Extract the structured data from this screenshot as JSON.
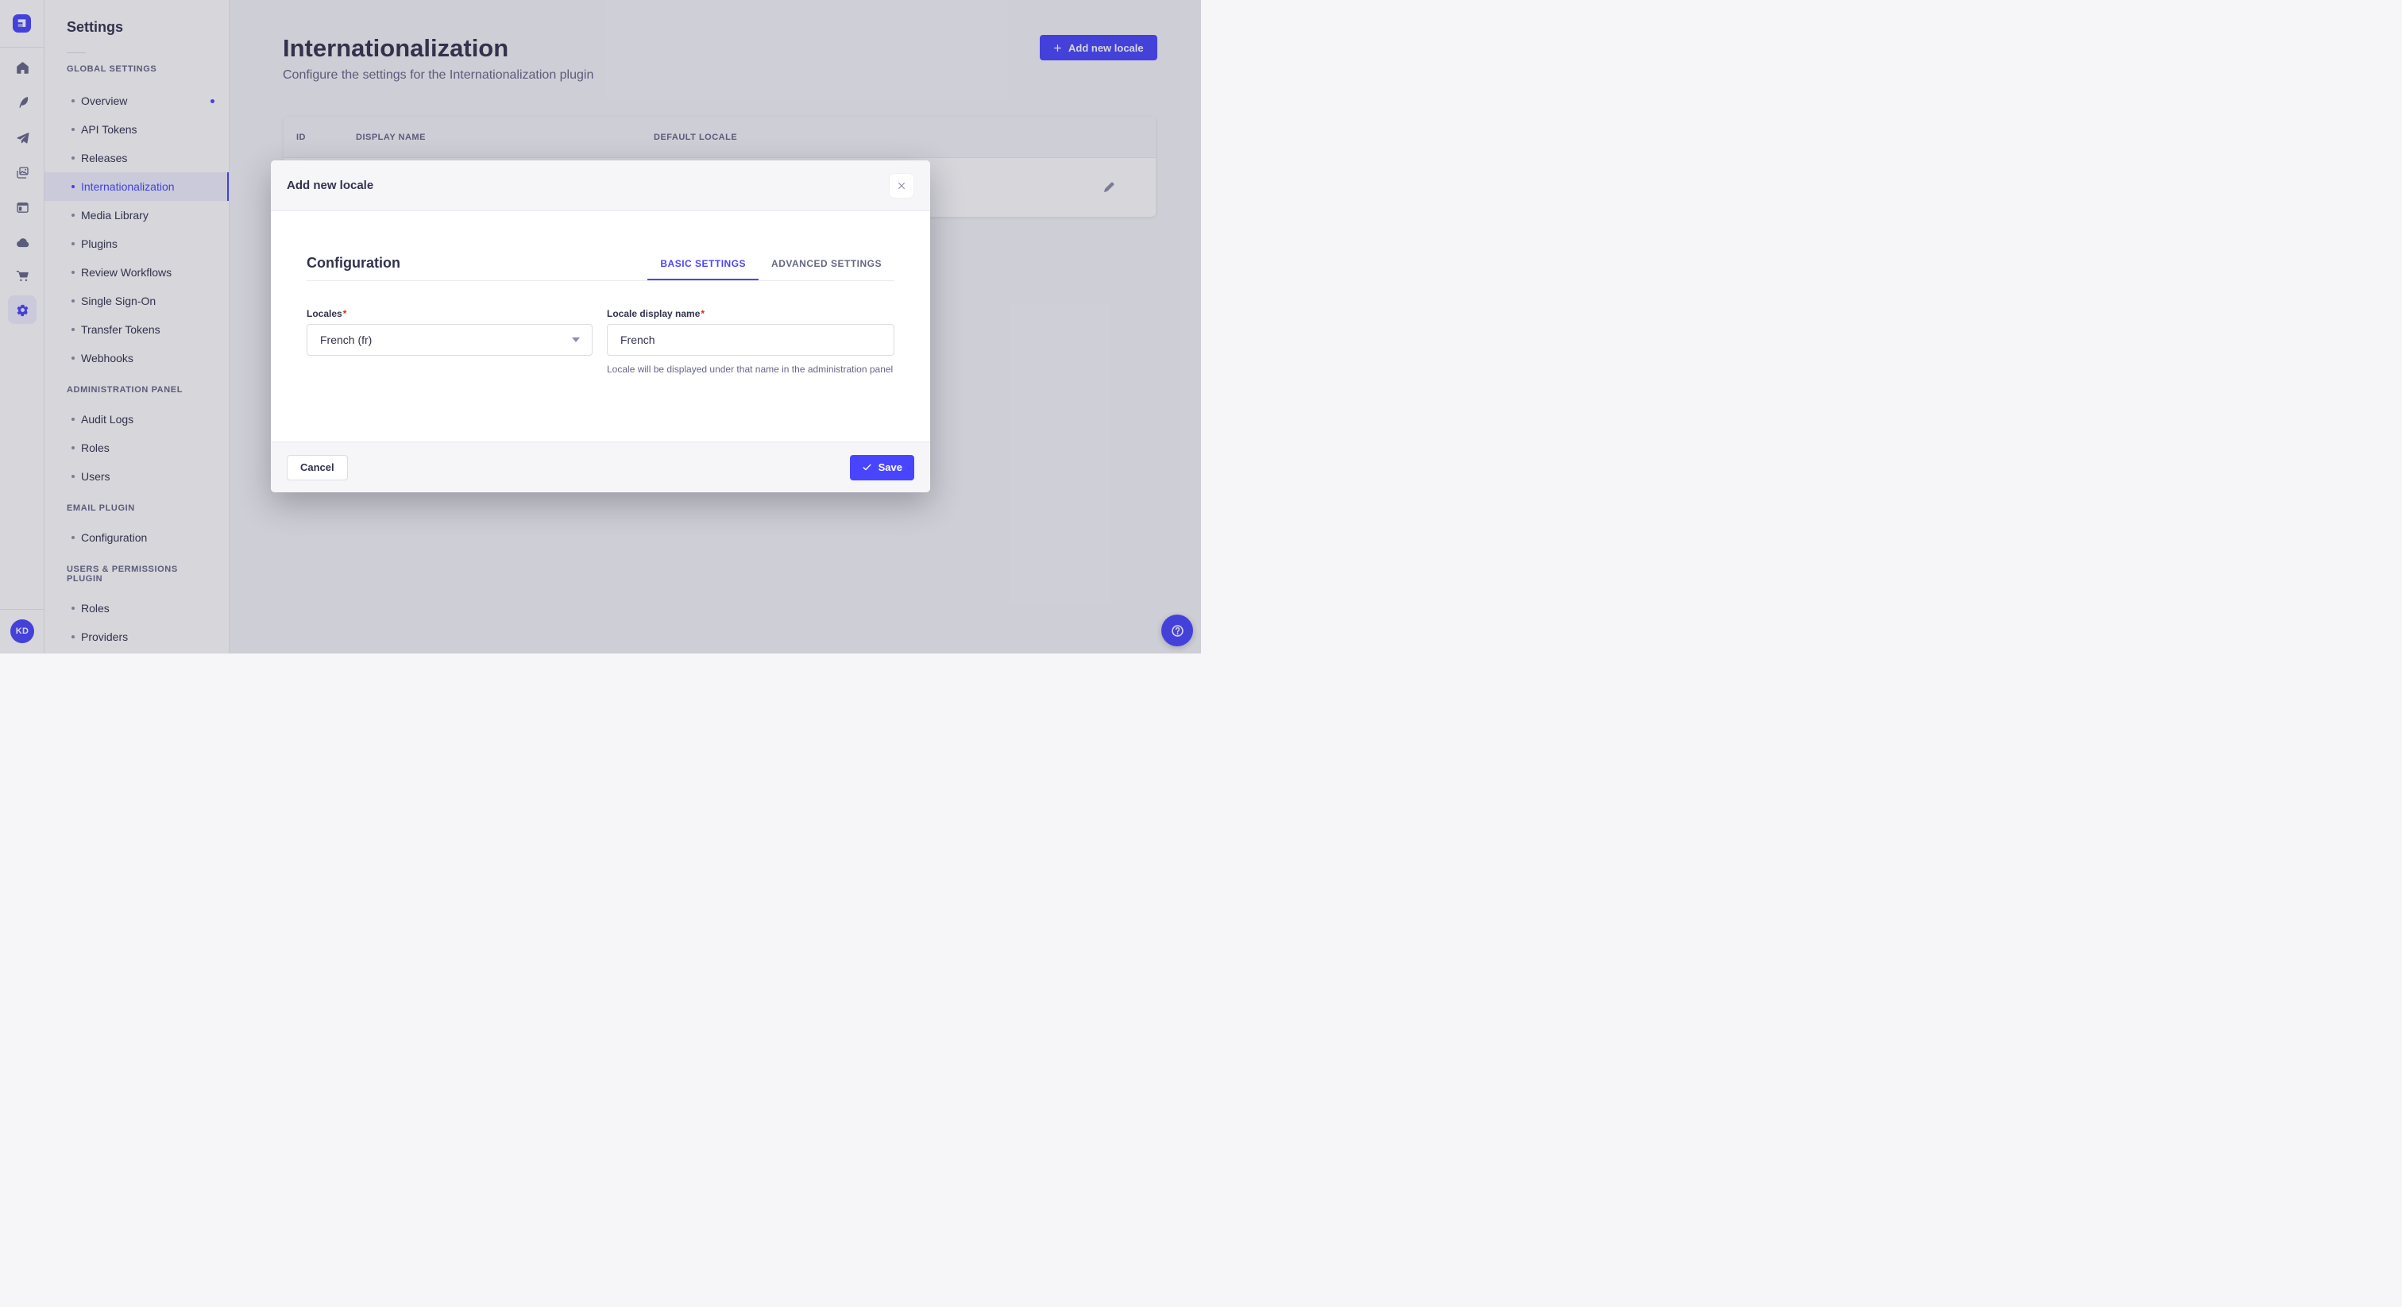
{
  "colors": {
    "primary": "#4945ff",
    "primary_light": "#f0f0ff",
    "danger": "#d02b20",
    "neutral_text": "#32324d",
    "muted_text": "#666687"
  },
  "rail": {
    "logo_icon": "strapi-logo",
    "icons": [
      "home",
      "feather",
      "paper-plane",
      "pictures",
      "layout",
      "cloud",
      "cart",
      "gear"
    ],
    "active_icon": "gear",
    "avatar_initials": "KD",
    "help_icon": "help-question"
  },
  "settings_nav": {
    "title": "Settings",
    "sections": [
      {
        "label": "GLOBAL SETTINGS",
        "items": [
          {
            "label": "Overview",
            "dot": true
          },
          {
            "label": "API Tokens"
          },
          {
            "label": "Releases"
          },
          {
            "label": "Internationalization",
            "active": true
          },
          {
            "label": "Media Library"
          },
          {
            "label": "Plugins"
          },
          {
            "label": "Review Workflows"
          },
          {
            "label": "Single Sign-On"
          },
          {
            "label": "Transfer Tokens"
          },
          {
            "label": "Webhooks"
          }
        ]
      },
      {
        "label": "ADMINISTRATION PANEL",
        "items": [
          {
            "label": "Audit Logs"
          },
          {
            "label": "Roles"
          },
          {
            "label": "Users"
          }
        ]
      },
      {
        "label": "EMAIL PLUGIN",
        "items": [
          {
            "label": "Configuration"
          }
        ]
      },
      {
        "label": "USERS & PERMISSIONS PLUGIN",
        "items": [
          {
            "label": "Roles"
          },
          {
            "label": "Providers"
          }
        ]
      }
    ]
  },
  "header": {
    "title": "Internationalization",
    "subtitle": "Configure the settings for the Internationalization plugin",
    "add_button": "Add new locale"
  },
  "table": {
    "columns": [
      "ID",
      "DISPLAY NAME",
      "DEFAULT LOCALE"
    ],
    "row_action_icon": "edit-pencil"
  },
  "modal": {
    "title": "Add new locale",
    "section_title": "Configuration",
    "tabs": [
      {
        "label": "BASIC SETTINGS",
        "active": true
      },
      {
        "label": "ADVANCED SETTINGS",
        "active": false
      }
    ],
    "required_marker": "*",
    "locales_label": "Locales",
    "locales_value": "French (fr)",
    "display_label": "Locale display name",
    "display_value": "French",
    "hint": "Locale will be displayed under that name in the administration panel",
    "cancel_label": "Cancel",
    "save_label": "Save"
  }
}
